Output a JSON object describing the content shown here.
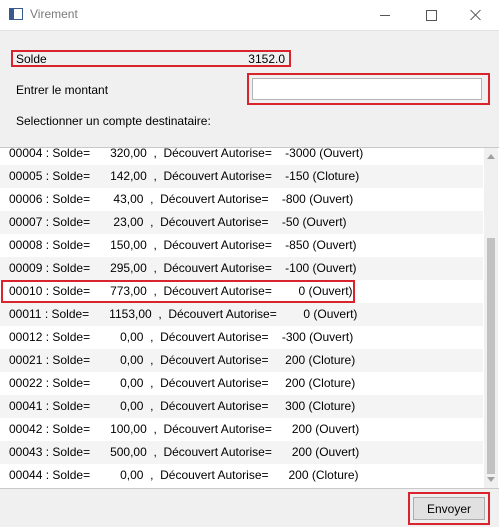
{
  "window": {
    "title": "Virement",
    "icon": "app-window-icon"
  },
  "solde": {
    "label": "Solde",
    "value": "3152.0"
  },
  "amount": {
    "label": "Entrer le montant",
    "value": "",
    "placeholder": ""
  },
  "destination": {
    "label": "Selectionner un compte destinataire:"
  },
  "accounts": [
    "00004 : Solde=      320,00  ,  Découvert Autorise=    -3000 (Ouvert)",
    "00005 : Solde=      142,00  ,  Découvert Autorise=    -150 (Cloture)",
    "00006 : Solde=       43,00  ,  Découvert Autorise=    -800 (Ouvert)",
    "00007 : Solde=       23,00  ,  Découvert Autorise=    -50 (Ouvert)",
    "00008 : Solde=      150,00  ,  Découvert Autorise=    -850 (Ouvert)",
    "00009 : Solde=      295,00  ,  Découvert Autorise=    -100 (Ouvert)",
    "00010 : Solde=      773,00  ,  Découvert Autorise=        0 (Ouvert)",
    "00011 : Solde=      1153,00  ,  Découvert Autorise=        0 (Ouvert)",
    "00012 : Solde=         0,00  ,  Découvert Autorise=    -300 (Ouvert)",
    "00021 : Solde=         0,00  ,  Découvert Autorise=     200 (Cloture)",
    "00022 : Solde=         0,00  ,  Découvert Autorise=     200 (Cloture)",
    "00041 : Solde=         0,00  ,  Découvert Autorise=     300 (Cloture)",
    "00042 : Solde=      100,00  ,  Découvert Autorise=      200 (Ouvert)",
    "00043 : Solde=      500,00  ,  Découvert Autorise=      200 (Ouvert)",
    "00044 : Solde=         0,00  ,  Découvert Autorise=      200 (Cloture)"
  ],
  "selected_index": 6,
  "send": {
    "label": "Envoyer"
  },
  "colors": {
    "highlight": "#d9232d"
  }
}
